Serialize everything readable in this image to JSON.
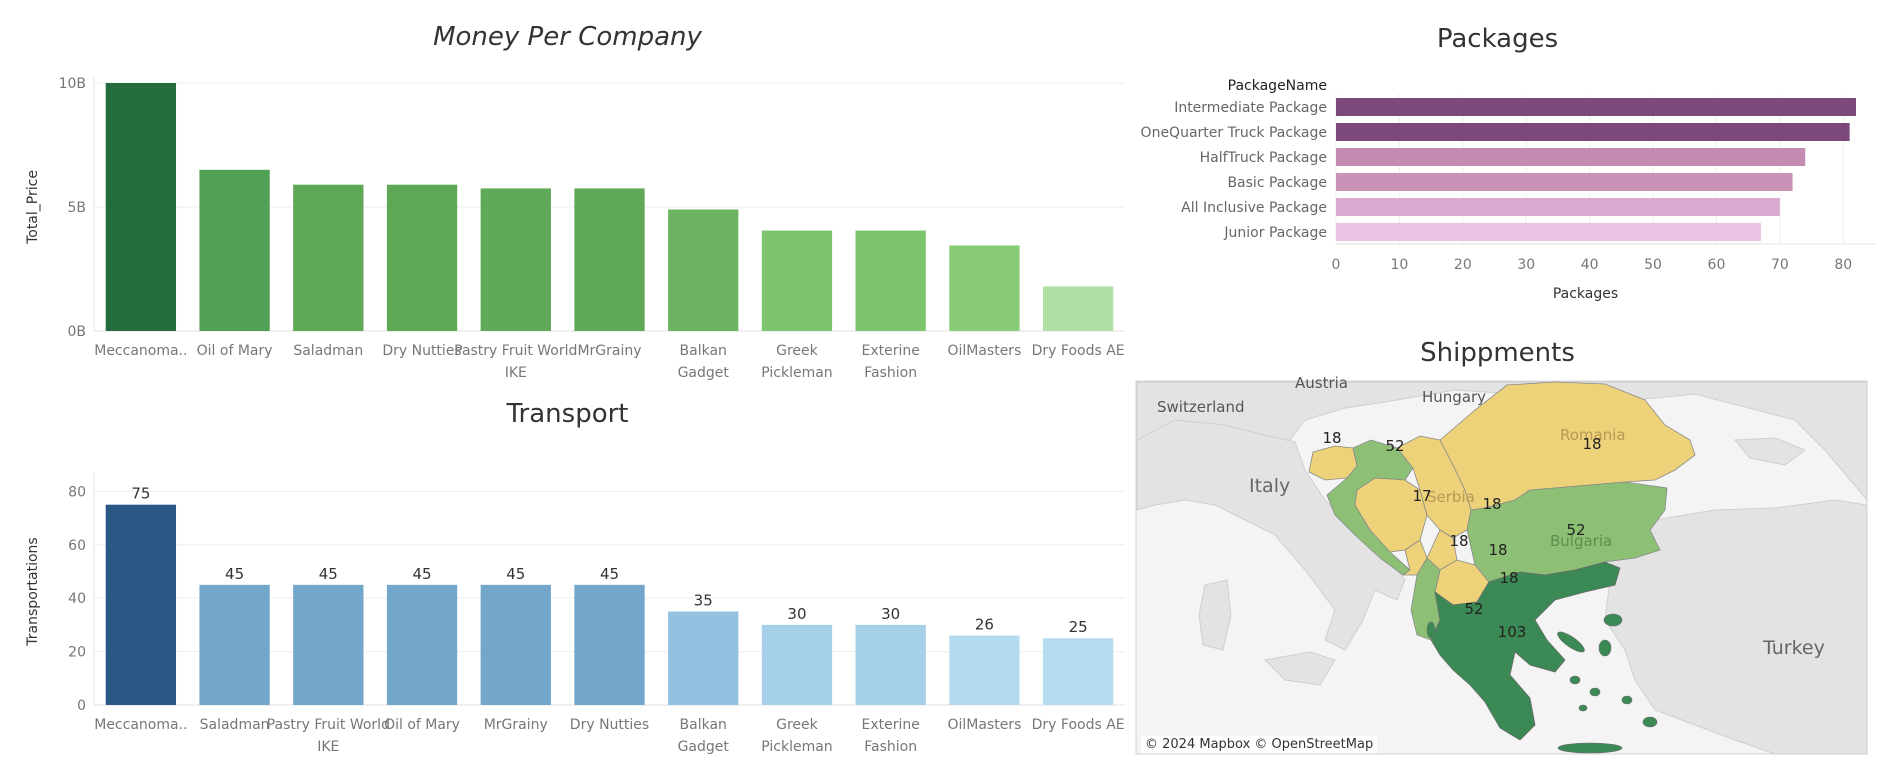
{
  "chart_data": [
    {
      "id": "money",
      "type": "bar",
      "title": "Money Per Company",
      "ylabel": "Total_Price",
      "ylim": [
        0,
        10
      ],
      "yticks": [
        0,
        5,
        10
      ],
      "ytick_labels": [
        "0B",
        "5B",
        "10B"
      ],
      "categories": [
        "Meccanoma..",
        "Oil of Mary",
        "Saladman",
        "Dry Nutties",
        "Pastry Fruit World IKE",
        "MrGrainy",
        "Balkan Gadget",
        "Greek Pickleman",
        "Exterine Fashion",
        "OilMasters",
        "Dry Foods AE"
      ],
      "values": [
        10.0,
        6.5,
        5.9,
        5.9,
        5.75,
        5.75,
        4.9,
        4.05,
        4.05,
        3.45,
        1.8
      ],
      "colors": [
        "#246c3d",
        "#52a055",
        "#5ea855",
        "#5ea855",
        "#60a958",
        "#60a958",
        "#6cb462",
        "#7cc46e",
        "#7cc46e",
        "#88cb78",
        "#b2e0a4"
      ]
    },
    {
      "id": "transport",
      "type": "bar",
      "title": "Transport",
      "ylabel": "Transportations",
      "ylim": [
        0,
        85
      ],
      "yticks": [
        0,
        20,
        40,
        60,
        80
      ],
      "categories": [
        "Meccanoma..",
        "Saladman",
        "Pastry Fruit World IKE",
        "Oil of Mary",
        "MrGrainy",
        "Dry Nutties",
        "Balkan Gadget",
        "Greek Pickleman",
        "Exterine Fashion",
        "OilMasters",
        "Dry Foods AE"
      ],
      "values": [
        75,
        45,
        45,
        45,
        45,
        45,
        35,
        30,
        30,
        26,
        25
      ],
      "colors": [
        "#2b5784",
        "#73a6cb",
        "#73a6cb",
        "#73a6cb",
        "#73a6cb",
        "#73a6cb",
        "#95c1e0",
        "#a6cfe9",
        "#a6cfe9",
        "#b4daf0",
        "#b6dcf2"
      ]
    },
    {
      "id": "packages",
      "type": "bar",
      "orientation": "horizontal",
      "title": "Packages",
      "xlabel": "Packages",
      "row_header": "PackageName",
      "xlim": [
        0,
        85
      ],
      "xticks": [
        0,
        10,
        20,
        30,
        40,
        50,
        60,
        70,
        80
      ],
      "categories": [
        "Intermediate Package",
        "OneQuarter Truck Package",
        "HalfTruck Package",
        "Basic Package",
        "All Inclusive Package",
        "Junior Package"
      ],
      "values": [
        82,
        81,
        74,
        72,
        70,
        67
      ],
      "colors": [
        "#7b4a7a",
        "#7b4a7a",
        "#c48bb0",
        "#c992b7",
        "#dcaad0",
        "#e8c4e2"
      ]
    }
  ],
  "map": {
    "title": "Shippments",
    "attribution": "© 2024 Mapbox © OpenStreetMap",
    "country_labels": [
      "Austria",
      "Hungary",
      "Switzerland",
      "Italy",
      "Romania",
      "Serbia",
      "Bulgaria",
      "Turkey"
    ],
    "regions": [
      {
        "name": "Slovenia",
        "value": 18,
        "color": "#eed27a"
      },
      {
        "name": "Croatia",
        "value": 52,
        "color": "#8dc075"
      },
      {
        "name": "Bosnia",
        "value": 17,
        "color": "#eed27a"
      },
      {
        "name": "Serbia",
        "value": 18,
        "color": "#eed27a"
      },
      {
        "name": "Montenegro",
        "value": 18,
        "color": "#eed27a"
      },
      {
        "name": "Kosovo",
        "value": 18,
        "color": "#eed27a"
      },
      {
        "name": "North Macedonia",
        "value": 18,
        "color": "#eed27a"
      },
      {
        "name": "Romania",
        "value": 18,
        "color": "#eed27a"
      },
      {
        "name": "Bulgaria",
        "value": 52,
        "color": "#8dc075"
      },
      {
        "name": "Albania",
        "value": 52,
        "color": "#8dc075"
      },
      {
        "name": "Greece",
        "value": 103,
        "color": "#3b8a56"
      }
    ],
    "colors": {
      "land": "#e6e6e6",
      "water": "#f6f6f6",
      "border": "#c8c8c8"
    }
  }
}
